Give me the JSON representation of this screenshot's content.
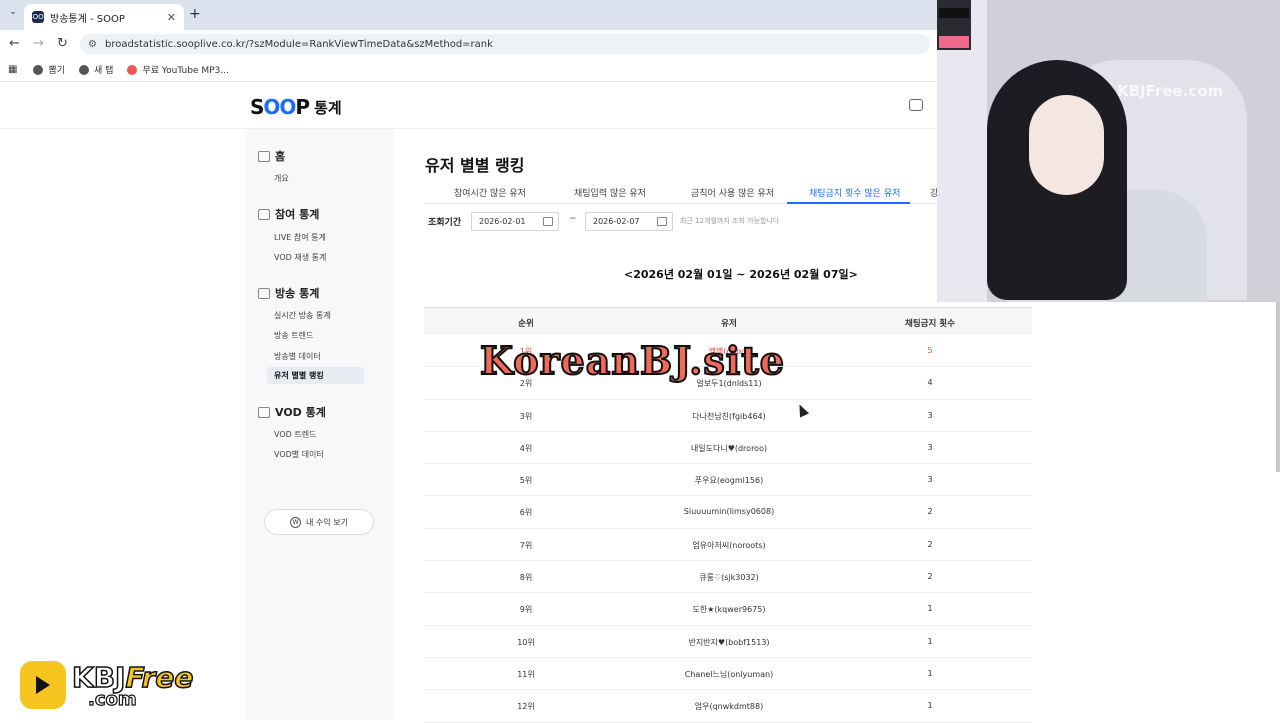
{
  "browser": {
    "tab_title": "방송통계 - SOOP",
    "tab_favicon": "SOOP",
    "tab_close": "✕",
    "new_tab": "+",
    "url": "broadstatistic.sooplive.co.kr/?szModule=RankViewTimeData&szMethod=rank",
    "bookmarks": [
      "뽐기",
      "새 탭",
      "무료 YouTube MP3..."
    ]
  },
  "header": {
    "logo_prefix": "S",
    "logo_mid": "OO",
    "logo_suffix": "P",
    "logo_label": "통계"
  },
  "sidebar": {
    "home": "홈",
    "overview": "개요",
    "participation_title": "참여 통계",
    "participation_items": [
      "LIVE 참여 통계",
      "VOD 재생 통계"
    ],
    "broadcast_title": "방송 통계",
    "broadcast_items": [
      "실시간 방송 통계",
      "방송 트렌드",
      "방송별 데이터",
      "유저 별별 랭킹"
    ],
    "vod_title": "VOD 통계",
    "vod_items": [
      "VOD 트렌드",
      "VOD별 데이터"
    ],
    "earn_button": "내 수익 보기",
    "earn_icon": "W"
  },
  "main": {
    "title": "유저 별별 랭킹",
    "tabs": [
      "참여시간 많은 유저",
      "채팅입력 많은 유저",
      "금칙어 사용 많은 유저",
      "채팅금지 횟수 많은 유저",
      "강"
    ],
    "active_tab_index": 3,
    "period_label": "조회기간",
    "start_date": "2026-02-01",
    "end_date": "2026-02-07",
    "date_separator": "~",
    "period_hint": "최근 12개월까지 조회 가능합니다",
    "range_title": "<2026년 02월 01일 ~ 2026년 02월 07일>",
    "table": {
      "headers": [
        "순위",
        "유저",
        "채팅금지 횟수"
      ],
      "rows": [
        [
          "1위",
          "깽깽(dood)",
          "5"
        ],
        [
          "2위",
          "얼보두1(dnlds11)",
          "4"
        ],
        [
          "3위",
          "다나천남친(fgib464)",
          "3"
        ],
        [
          "4위",
          "내일도다니♥(droroo)",
          "3"
        ],
        [
          "5위",
          "푸우요(eogml156)",
          "3"
        ],
        [
          "6위",
          "Siuuuumin(limsy0608)",
          "2"
        ],
        [
          "7위",
          "엄유아저씨(noroots)",
          "2"
        ],
        [
          "8위",
          "큐룽♡(sjk3032)",
          "2"
        ],
        [
          "9위",
          "도한★(kqwer9675)",
          "1"
        ],
        [
          "10위",
          "반지반지♥(bobf1513)",
          "1"
        ],
        [
          "11위",
          "Chanel느님(onlyuman)",
          "1"
        ],
        [
          "12위",
          "엄우(qnwkdmt88)",
          "1"
        ]
      ]
    }
  },
  "overlays": {
    "center_watermark": "KoreanBJ.site",
    "cam_watermark": "KBJFree.com",
    "logo_kbj": "KBJ",
    "logo_free": "Free",
    "logo_com": ".com"
  },
  "colors": {
    "accent": "#1f6bff",
    "top_rank": "#e94a4a"
  },
  "icons": {
    "back": "←",
    "forward": "→",
    "reload": "↻",
    "menu": "⌄"
  }
}
